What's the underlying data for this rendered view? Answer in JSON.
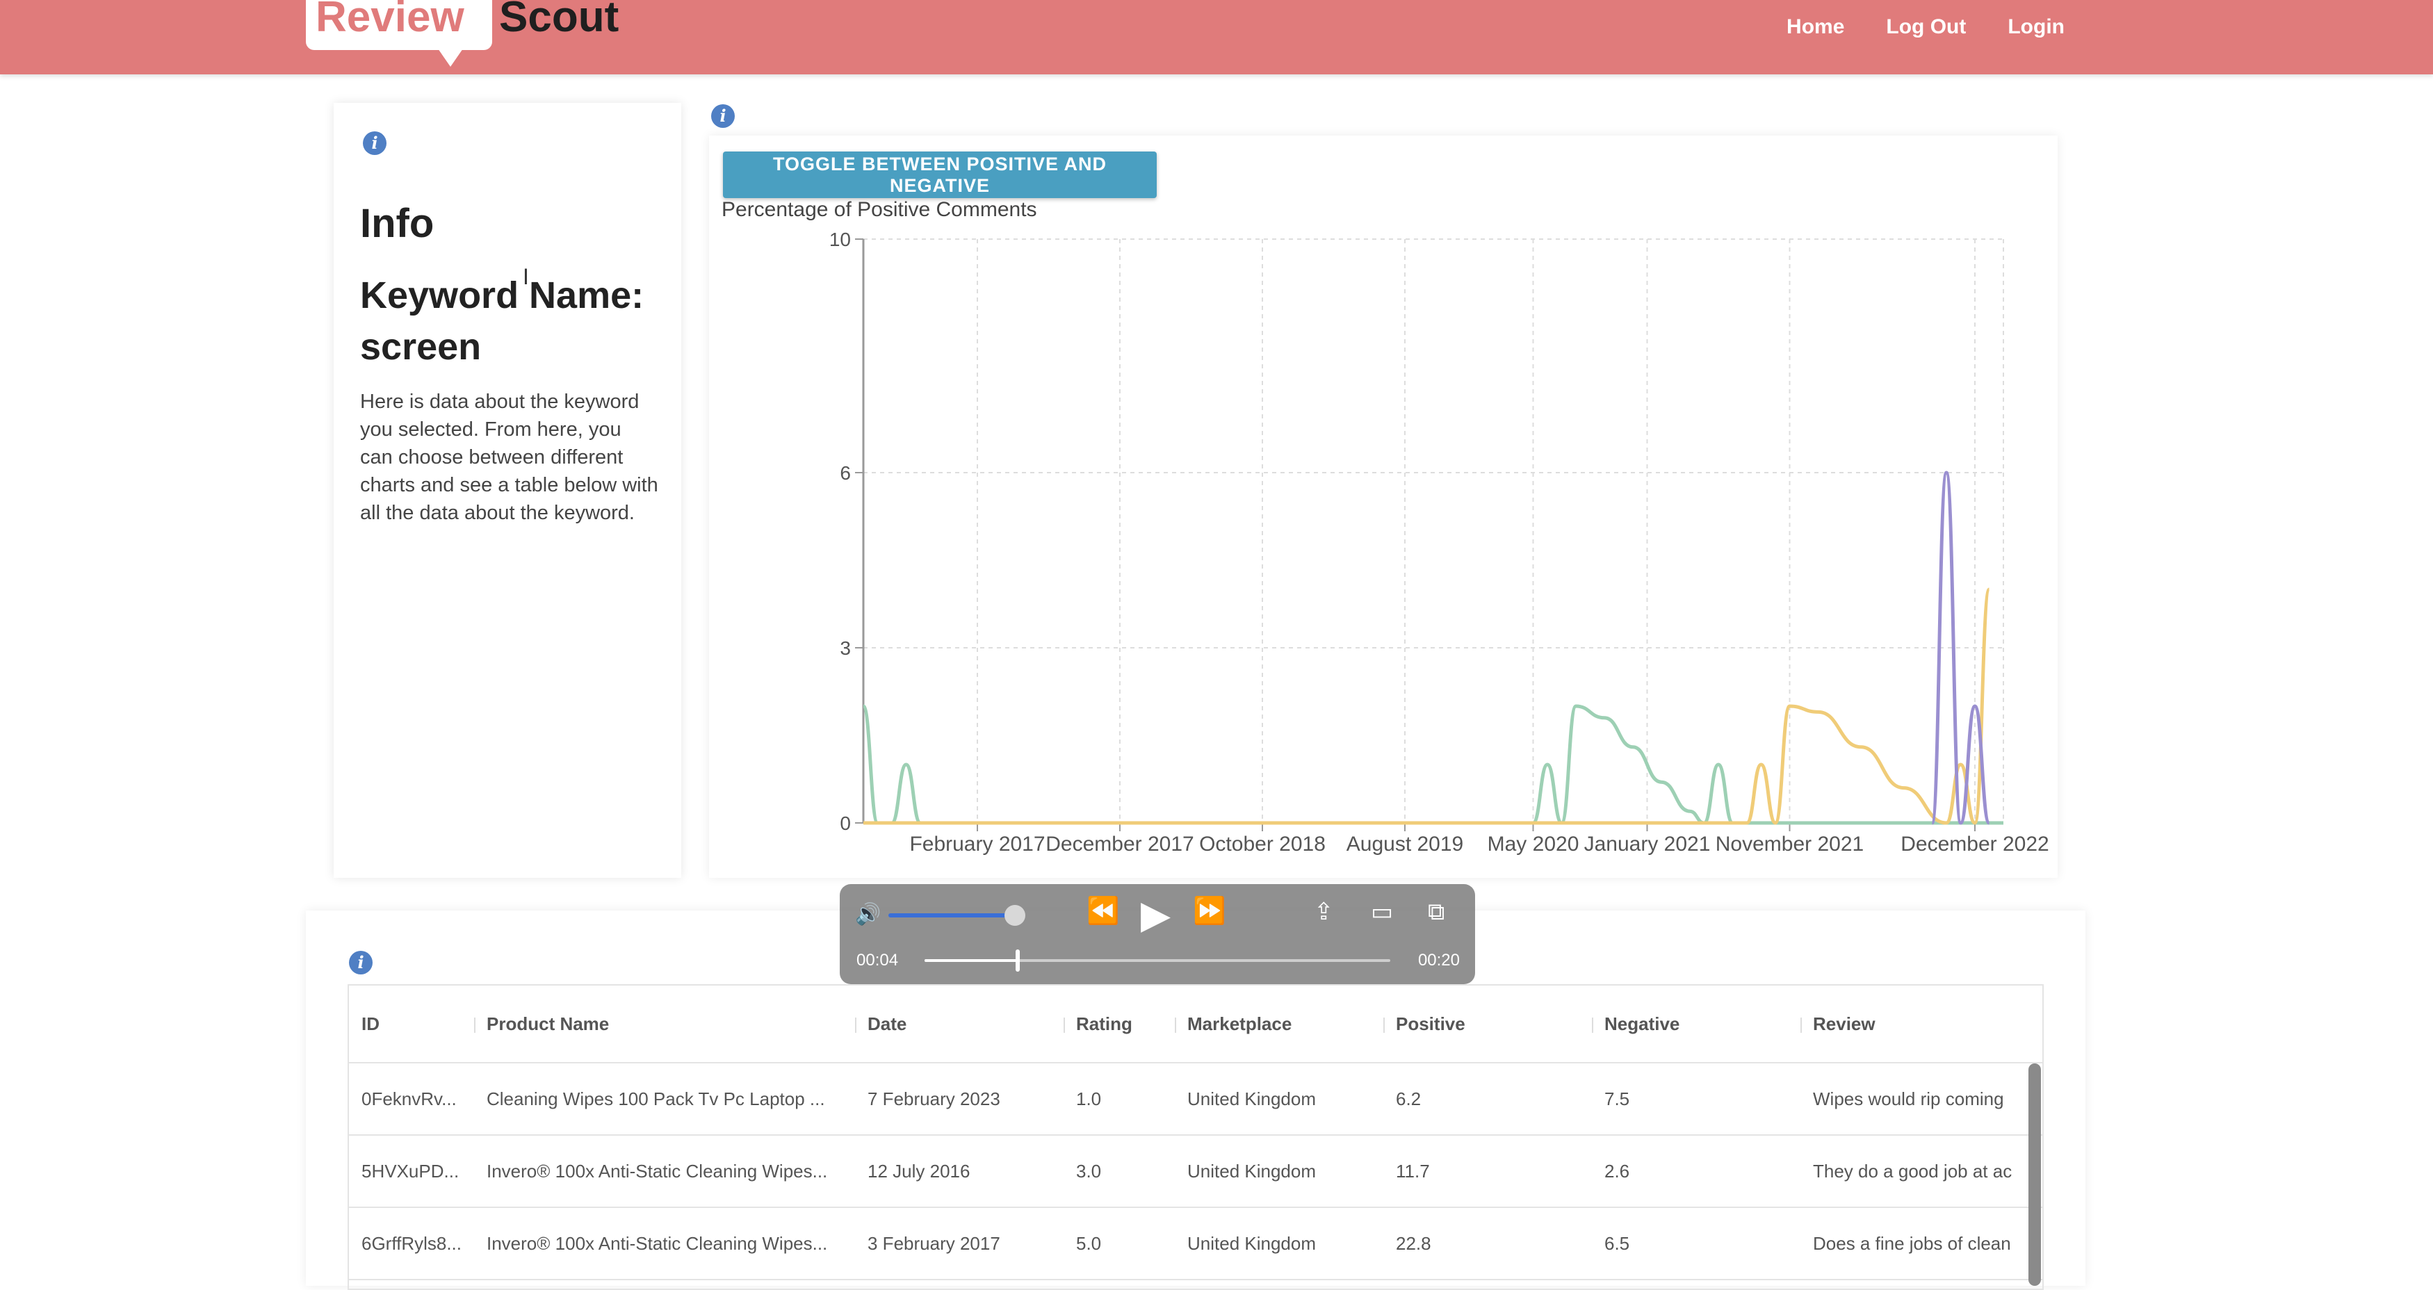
{
  "header": {
    "logo_review": "Review",
    "logo_scout": "Scout",
    "nav": [
      "Home",
      "Log Out",
      "Login"
    ]
  },
  "info": {
    "title": "Info",
    "keyword_title": "Keyword Name: screen",
    "description": "Here is data about the keyword you selected. From here, you can choose between different charts and see a table below with all the data about the keyword."
  },
  "chart_panel": {
    "toggle_label": "TOGGLE BETWEEN POSITIVE AND NEGATIVE",
    "title": "Percentage of Positive Comments"
  },
  "chart_data": {
    "type": "line",
    "title": "Percentage of Positive Comments",
    "xlabel": "",
    "ylabel": "",
    "x_ticks": [
      "February 2017",
      "December 2017",
      "October 2018",
      "August 2019",
      "May 2020",
      "January 2021",
      "November 2021",
      "December 2022"
    ],
    "y_ticks": [
      0,
      3,
      6,
      10
    ],
    "ylim": [
      0,
      10
    ],
    "xlim": [
      "2016-06",
      "2023-02"
    ],
    "grid": true,
    "colors": {
      "green": "#9dd0b4",
      "yellow": "#f0cc78",
      "purple": "#9a8fd0"
    },
    "series": [
      {
        "color": "green",
        "points": [
          [
            "2016-06",
            2.0
          ],
          [
            "2016-07",
            0
          ],
          [
            "2016-08",
            0
          ],
          [
            "2016-09",
            1.0
          ],
          [
            "2016-10",
            0
          ],
          [
            "2020-05",
            0
          ],
          [
            "2020-06",
            1.0
          ],
          [
            "2020-07",
            0
          ],
          [
            "2020-08",
            2.0
          ],
          [
            "2020-10",
            1.8
          ],
          [
            "2020-12",
            1.3
          ],
          [
            "2021-02",
            0.7
          ],
          [
            "2021-04",
            0.2
          ],
          [
            "2021-05",
            0
          ],
          [
            "2021-06",
            1.0
          ],
          [
            "2021-07",
            0
          ],
          [
            "2023-02",
            0
          ]
        ]
      },
      {
        "color": "yellow",
        "points": [
          [
            "2016-06",
            0
          ],
          [
            "2021-08",
            0
          ],
          [
            "2021-09",
            1.0
          ],
          [
            "2021-10",
            0
          ],
          [
            "2021-11",
            2.0
          ],
          [
            "2022-01",
            1.9
          ],
          [
            "2022-04",
            1.3
          ],
          [
            "2022-07",
            0.6
          ],
          [
            "2022-10",
            0
          ],
          [
            "2022-11",
            1.0
          ],
          [
            "2022-12",
            0
          ],
          [
            "2023-01",
            4.0
          ]
        ]
      },
      {
        "color": "purple",
        "points": [
          [
            "2022-09",
            0
          ],
          [
            "2022-10",
            6.0
          ],
          [
            "2022-11",
            0
          ],
          [
            "2022-12",
            2.0
          ],
          [
            "2023-01",
            0
          ]
        ]
      }
    ]
  },
  "table": {
    "columns": [
      "ID",
      "Product Name",
      "Date",
      "Rating",
      "Marketplace",
      "Positive",
      "Negative",
      "Review"
    ],
    "rows": [
      [
        "0FeknvRv...",
        "Cleaning Wipes 100 Pack Tv Pc Laptop ...",
        "7 February 2023",
        "1.0",
        "United Kingdom",
        "6.2",
        "7.5",
        "Wipes would rip coming"
      ],
      [
        "5HVXuPD...",
        "Invero® 100x Anti-Static Cleaning Wipes...",
        "12 July 2016",
        "3.0",
        "United Kingdom",
        "11.7",
        "2.6",
        "They do a good job at ac"
      ],
      [
        "6GrffRyls8...",
        "Invero® 100x Anti-Static Cleaning Wipes...",
        "3 February 2017",
        "5.0",
        "United Kingdom",
        "22.8",
        "6.5",
        "Does a fine jobs of clean"
      ]
    ]
  },
  "media": {
    "current_time": "00:04",
    "total_time": "00:20",
    "progress": 0.2,
    "volume": 0.85
  }
}
